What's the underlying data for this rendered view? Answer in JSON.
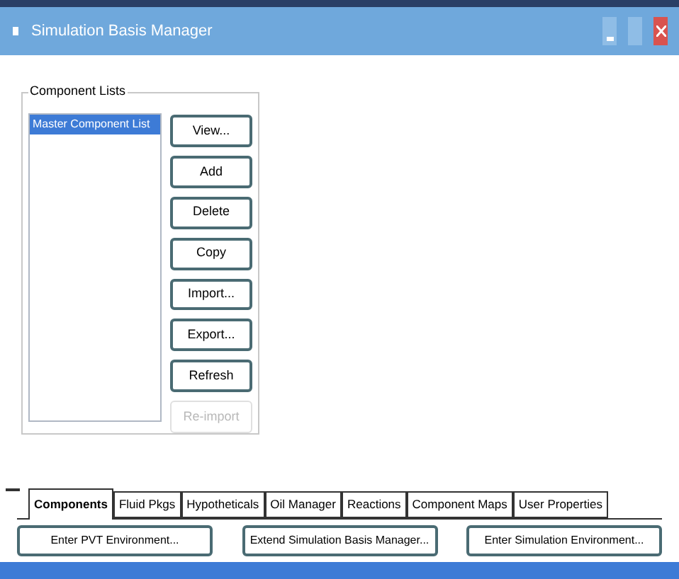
{
  "window": {
    "title": "Simulation Basis Manager"
  },
  "component_lists": {
    "label": "Component Lists",
    "items": [
      {
        "label": "Master Component List",
        "selected": true
      }
    ],
    "buttons": [
      {
        "label": "View...",
        "disabled": false
      },
      {
        "label": "Add",
        "disabled": false
      },
      {
        "label": "Delete",
        "disabled": false
      },
      {
        "label": "Copy",
        "disabled": false
      },
      {
        "label": "Import...",
        "disabled": false
      },
      {
        "label": "Export...",
        "disabled": false
      },
      {
        "label": "Refresh",
        "disabled": false
      },
      {
        "label": "Re-import",
        "disabled": true
      }
    ]
  },
  "tabs": [
    {
      "label": "Components",
      "selected": true
    },
    {
      "label": "Fluid Pkgs",
      "selected": false
    },
    {
      "label": "Hypotheticals",
      "selected": false
    },
    {
      "label": "Oil Manager",
      "selected": false
    },
    {
      "label": "Reactions",
      "selected": false
    },
    {
      "label": "Component Maps",
      "selected": false
    },
    {
      "label": "User Properties",
      "selected": false
    }
  ],
  "footer_buttons": [
    "Enter PVT Environment...",
    "Extend Simulation Basis Manager...",
    "Enter Simulation Environment..."
  ]
}
